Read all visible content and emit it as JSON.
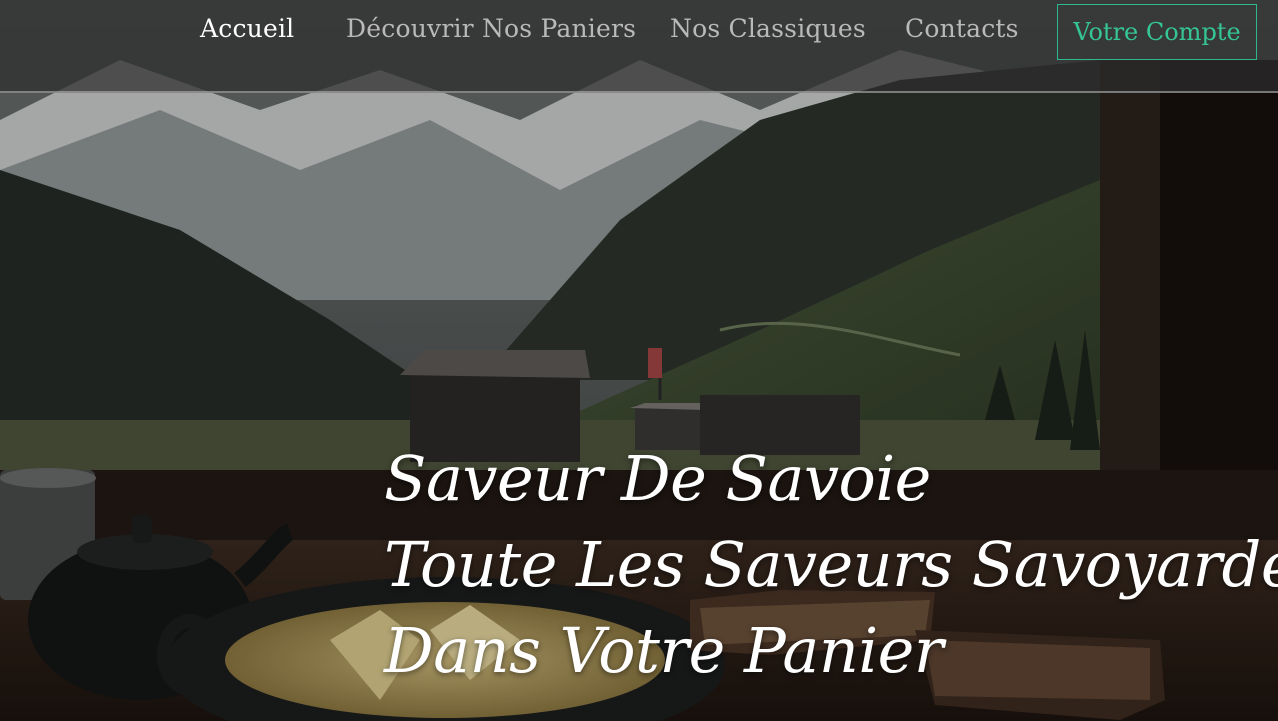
{
  "nav": {
    "items": [
      {
        "label": "Accueil",
        "active": true
      },
      {
        "label": "Découvrir Nos Paniers",
        "active": false
      },
      {
        "label": "Nos Classiques",
        "active": false
      },
      {
        "label": "Contacts",
        "active": false
      }
    ],
    "account_label": "Votre Compte"
  },
  "hero": {
    "lines": [
      "Saveur De Savoie",
      "Toute Les Saveurs Savoyarde",
      "Dans Votre Panier"
    ]
  },
  "colors": {
    "accent": "#35c596",
    "nav_text": "#b9b9b9",
    "nav_active": "#ffffff",
    "nav_background": "#2d2d2d"
  }
}
